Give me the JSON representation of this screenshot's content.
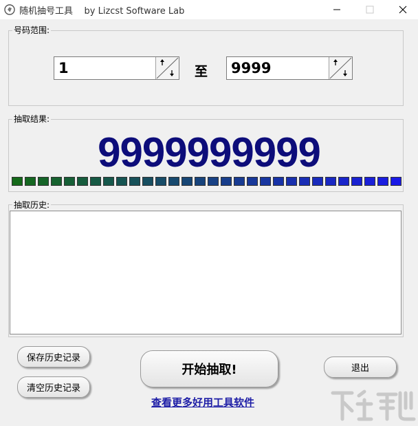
{
  "window": {
    "title": "随机抽号工具    by Lizcst Software Lab",
    "controls": [
      "minimize",
      "maximize",
      "close"
    ]
  },
  "range": {
    "label": "号码范围:",
    "from_value": "1",
    "to_label": "至",
    "to_value": "9999"
  },
  "result": {
    "label": "抽取结果:",
    "number": "9999999999",
    "progress_segments": 30,
    "progress_start_color": "#156a1a",
    "progress_end_color": "#1a1ae6"
  },
  "history": {
    "label": "抽取历史:",
    "content": ""
  },
  "buttons": {
    "save_history": "保存历史记录",
    "clear_history": "清空历史记录",
    "start": "开始抽取!",
    "exit": "退出"
  },
  "link": {
    "text": "查看更多好用工具软件"
  },
  "colors": {
    "result_number": "#0d0d7a",
    "link": "#1d1da6"
  }
}
